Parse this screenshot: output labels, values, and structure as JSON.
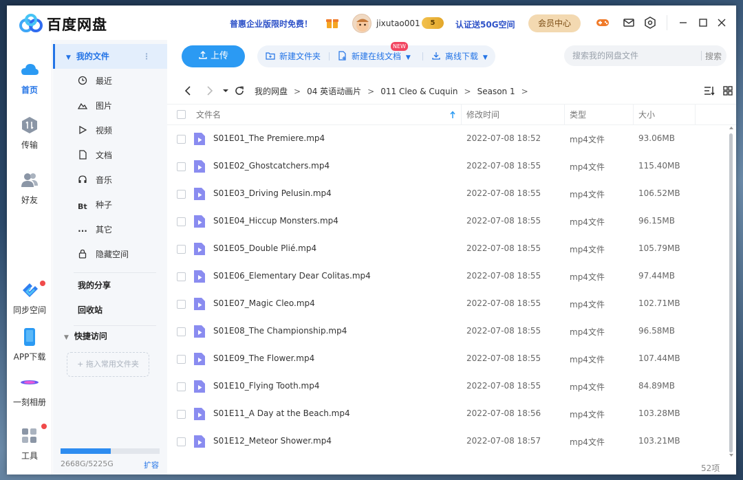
{
  "app": {
    "name": "百度网盘"
  },
  "titlebar": {
    "promo": "普惠企业版限时免费！",
    "username": "jixutao001",
    "vip_badge": "5",
    "certify": "认证送50G空间",
    "member_center": "会员中心"
  },
  "rail": {
    "items": [
      {
        "label": "首页",
        "icon": "cloud-icon",
        "active": true
      },
      {
        "label": "传输",
        "icon": "transfer-icon"
      },
      {
        "label": "好友",
        "icon": "friends-icon"
      },
      {
        "label": "同步空间",
        "icon": "sync-space-icon"
      },
      {
        "label": "APP下载",
        "icon": "phone-icon"
      },
      {
        "label": "一刻相册",
        "icon": "album-icon"
      },
      {
        "label": "工具",
        "icon": "tools-icon"
      }
    ]
  },
  "sidebar": {
    "my_files": "我的文件",
    "items": [
      {
        "label": "最近",
        "icon": "clock-icon"
      },
      {
        "label": "图片",
        "icon": "image-icon"
      },
      {
        "label": "视频",
        "icon": "play-icon"
      },
      {
        "label": "文档",
        "icon": "document-icon"
      },
      {
        "label": "音乐",
        "icon": "headphones-icon"
      },
      {
        "label": "种子",
        "icon": "bt-icon"
      },
      {
        "label": "其它",
        "icon": "more-icon"
      },
      {
        "label": "隐藏空间",
        "icon": "lock-icon"
      }
    ],
    "my_share": "我的分享",
    "recycle_bin": "回收站",
    "quick_access": "快捷访问",
    "drop_hint": "+ 拖入常用文件夹",
    "storage": {
      "text": "2668G/5225G",
      "used_fraction": 0.51,
      "expand": "扩容"
    }
  },
  "toolbar": {
    "upload": "上传",
    "new_folder": "新建文件夹",
    "new_online_doc": "新建在线文档",
    "new_badge": "NEW",
    "offline_download": "离线下载",
    "search_placeholder": "搜索我的网盘文件",
    "search_button": "搜索"
  },
  "breadcrumb": [
    "我的网盘",
    "04 英语动画片",
    "011 Cleo & Cuquin",
    "Season 1"
  ],
  "table": {
    "headers": {
      "name": "文件名",
      "modified": "修改时间",
      "type": "类型",
      "size": "大小"
    },
    "rows": [
      {
        "name": "S01E01_The Premiere.mp4",
        "modified": "2022-07-08 18:52",
        "type": "mp4文件",
        "size": "93.06MB"
      },
      {
        "name": "S01E02_Ghostcatchers.mp4",
        "modified": "2022-07-08 18:55",
        "type": "mp4文件",
        "size": "115.40MB"
      },
      {
        "name": "S01E03_Driving Pelusin.mp4",
        "modified": "2022-07-08 18:55",
        "type": "mp4文件",
        "size": "106.52MB"
      },
      {
        "name": "S01E04_Hiccup Monsters.mp4",
        "modified": "2022-07-08 18:55",
        "type": "mp4文件",
        "size": "96.15MB"
      },
      {
        "name": "S01E05_Double Plié.mp4",
        "modified": "2022-07-08 18:55",
        "type": "mp4文件",
        "size": "105.79MB"
      },
      {
        "name": "S01E06_Elementary Dear Colitas.mp4",
        "modified": "2022-07-08 18:55",
        "type": "mp4文件",
        "size": "97.44MB"
      },
      {
        "name": "S01E07_Magic Cleo.mp4",
        "modified": "2022-07-08 18:55",
        "type": "mp4文件",
        "size": "102.71MB"
      },
      {
        "name": "S01E08_The Championship.mp4",
        "modified": "2022-07-08 18:55",
        "type": "mp4文件",
        "size": "96.58MB"
      },
      {
        "name": "S01E09_The Flower.mp4",
        "modified": "2022-07-08 18:55",
        "type": "mp4文件",
        "size": "107.44MB"
      },
      {
        "name": "S01E10_Flying Tooth.mp4",
        "modified": "2022-07-08 18:55",
        "type": "mp4文件",
        "size": "84.89MB"
      },
      {
        "name": "S01E11_A Day at the Beach.mp4",
        "modified": "2022-07-08 18:56",
        "type": "mp4文件",
        "size": "103.28MB"
      },
      {
        "name": "S01E12_Meteor Shower.mp4",
        "modified": "2022-07-08 18:57",
        "type": "mp4文件",
        "size": "103.21MB"
      }
    ],
    "count": "52项"
  },
  "colors": {
    "accent": "#2273e6",
    "upload": "#2b9af3",
    "video_icon": "#8a8cf0"
  }
}
